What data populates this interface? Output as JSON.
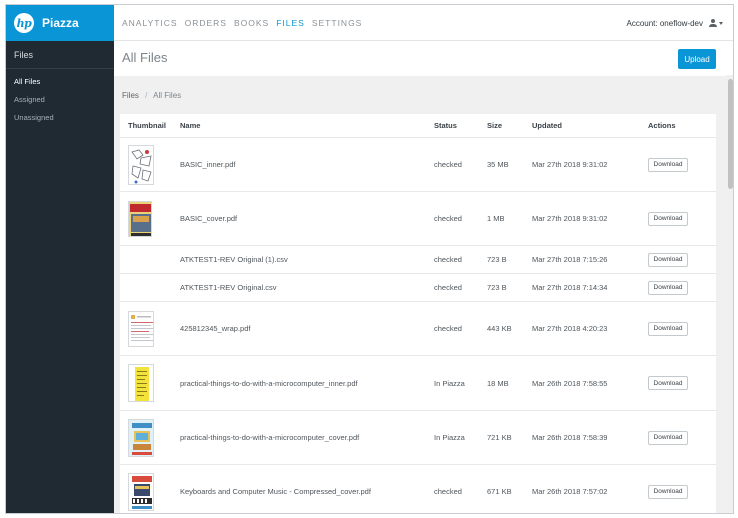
{
  "app": {
    "name": "Piazza",
    "logo_text": "hp"
  },
  "nav": {
    "items": [
      {
        "label": "ANALYTICS",
        "active": false
      },
      {
        "label": "ORDERS",
        "active": false
      },
      {
        "label": "BOOKS",
        "active": false
      },
      {
        "label": "FILES",
        "active": true
      },
      {
        "label": "SETTINGS",
        "active": false
      }
    ]
  },
  "account": {
    "label": "Account: oneflow-dev",
    "icon": "user-icon"
  },
  "sidebar": {
    "title": "Files",
    "items": [
      {
        "label": "All Files",
        "active": true
      },
      {
        "label": "Assigned",
        "active": false
      },
      {
        "label": "Unassigned",
        "active": false
      }
    ]
  },
  "page": {
    "title": "All Files",
    "upload_label": "Upload",
    "breadcrumb": {
      "root": "Files",
      "separator": "/",
      "current": "All Files"
    }
  },
  "table": {
    "headers": {
      "thumbnail": "Thumbnail",
      "name": "Name",
      "status": "Status",
      "size": "Size",
      "updated": "Updated",
      "actions": "Actions"
    },
    "download_label": "Download",
    "rows": [
      {
        "name": "BASIC_inner.pdf",
        "status": "checked",
        "size": "35 MB",
        "updated": "Mar 27th 2018 9:31:02",
        "thumbnail": "line-art"
      },
      {
        "name": "BASIC_cover.pdf",
        "status": "checked",
        "size": "1 MB",
        "updated": "Mar 27th 2018 9:31:02",
        "thumbnail": "basic-cover"
      },
      {
        "name": "ATKTEST1-REV Original (1).csv",
        "status": "checked",
        "size": "723 B",
        "updated": "Mar 27th 2018 7:15:26",
        "thumbnail": ""
      },
      {
        "name": "ATKTEST1-REV Original.csv",
        "status": "checked",
        "size": "723 B",
        "updated": "Mar 27th 2018 7:14:34",
        "thumbnail": ""
      },
      {
        "name": "425812345_wrap.pdf",
        "status": "checked",
        "size": "443 KB",
        "updated": "Mar 27th 2018 4:20:23",
        "thumbnail": "text-page"
      },
      {
        "name": "practical-things-to-do-with-a-microcomputer_inner.pdf",
        "status": "In Piazza",
        "size": "18 MB",
        "updated": "Mar 26th 2018 7:58:55",
        "thumbnail": "yellow-page"
      },
      {
        "name": "practical-things-to-do-with-a-microcomputer_cover.pdf",
        "status": "In Piazza",
        "size": "721 KB",
        "updated": "Mar 26th 2018 7:58:39",
        "thumbnail": "computer-cover"
      },
      {
        "name": "Keyboards and Computer Music - Compressed_cover.pdf",
        "status": "checked",
        "size": "671 KB",
        "updated": "Mar 26th 2018 7:57:02",
        "thumbnail": "keyboards-cover"
      }
    ]
  },
  "colors": {
    "accent": "#0a96d6",
    "sidebar_bg": "#1f2a33",
    "page_bg": "#f0f0f0"
  }
}
